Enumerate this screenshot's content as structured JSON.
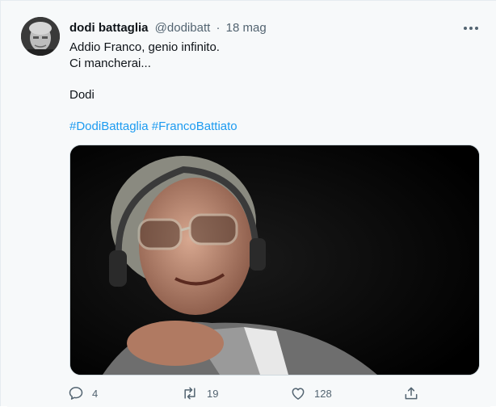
{
  "tweet": {
    "author_name": "dodi battaglia",
    "handle": "@dodibatt",
    "separator": "·",
    "date": "18 mag",
    "text_line1": "Addio Franco, genio infinito.",
    "text_line2": "Ci mancherai...",
    "signature": "Dodi",
    "hashtag1": "#DodiBattaglia",
    "hashtag2": "#FrancoBattiato"
  },
  "actions": {
    "reply_count": "4",
    "retweet_count": "19",
    "like_count": "128"
  },
  "icons": {
    "more": "more-icon",
    "reply": "reply-icon",
    "retweet": "retweet-icon",
    "like": "heart-icon",
    "share": "share-icon"
  },
  "colors": {
    "link": "#1d9bf0",
    "secondary_text": "#536471",
    "primary_text": "#0f1419",
    "background": "#f7f9fa"
  }
}
